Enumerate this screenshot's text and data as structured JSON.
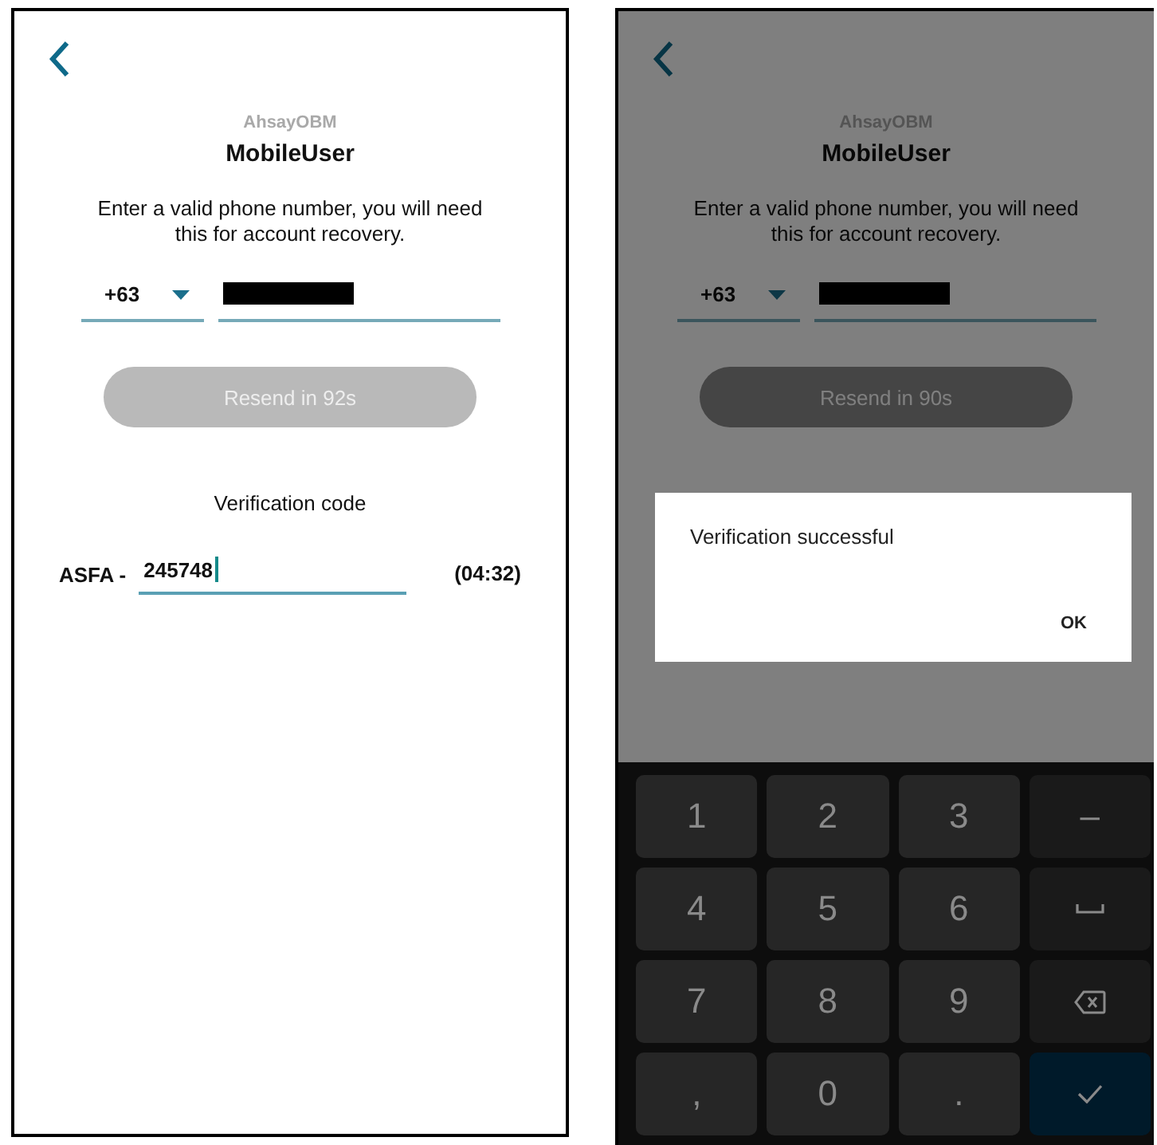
{
  "screens": [
    {
      "dimmed": false,
      "app_name": "AhsayOBM",
      "user": "MobileUser",
      "instruction": "Enter a valid phone number, you will need this for account recovery.",
      "country_code": "+63",
      "resend_button": "Resend in 92s",
      "verification": {
        "label": "Verification code",
        "prefix": "ASFA -",
        "value": "245748",
        "timer": "(04:32)"
      }
    },
    {
      "dimmed": true,
      "app_name": "AhsayOBM",
      "user": "MobileUser",
      "instruction": "Enter a valid phone number, you will need this for account recovery.",
      "country_code": "+63",
      "resend_button": "Resend in 90s",
      "dialog": {
        "message": "Verification successful",
        "button": "OK"
      },
      "keyboard": [
        {
          "kind": "char",
          "label": "1"
        },
        {
          "kind": "char",
          "label": "2"
        },
        {
          "kind": "char",
          "label": "3"
        },
        {
          "kind": "side",
          "label": "–"
        },
        {
          "kind": "char",
          "label": "4"
        },
        {
          "kind": "char",
          "label": "5"
        },
        {
          "kind": "char",
          "label": "6"
        },
        {
          "kind": "space"
        },
        {
          "kind": "char",
          "label": "7"
        },
        {
          "kind": "char",
          "label": "8"
        },
        {
          "kind": "char",
          "label": "9"
        },
        {
          "kind": "backspace"
        },
        {
          "kind": "char",
          "label": ","
        },
        {
          "kind": "char",
          "label": "0"
        },
        {
          "kind": "char",
          "label": "."
        },
        {
          "kind": "done"
        }
      ]
    }
  ]
}
